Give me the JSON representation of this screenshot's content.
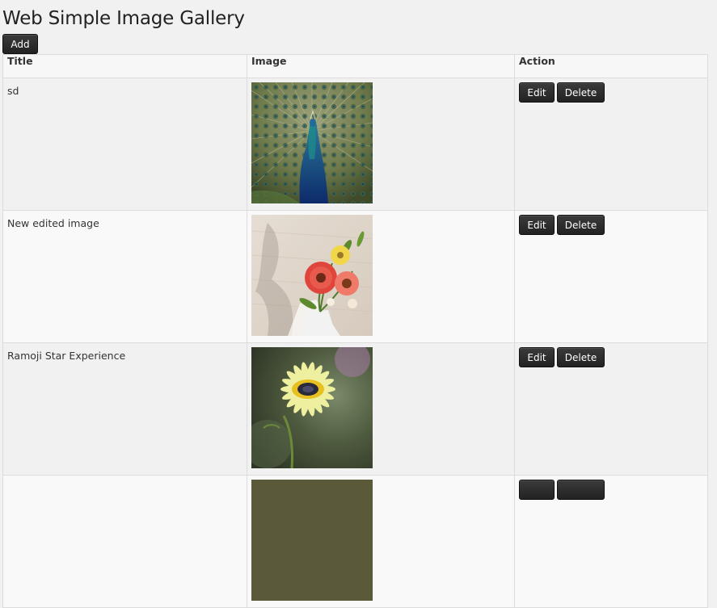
{
  "page": {
    "title": "Web Simple Image Gallery",
    "add_label": "Add"
  },
  "table": {
    "headers": {
      "title": "Title",
      "image": "Image",
      "action": "Action"
    },
    "rows": [
      {
        "title": "sd",
        "image": "peacock-photo",
        "edit_label": "Edit",
        "delete_label": "Delete"
      },
      {
        "title": "New edited image",
        "image": "gerbera-bouquet-photo",
        "edit_label": "Edit",
        "delete_label": "Delete"
      },
      {
        "title": "Ramoji Star Experience",
        "image": "yellow-daisy-photo",
        "edit_label": "Edit",
        "delete_label": "Delete"
      },
      {
        "title": "",
        "image": "partial-photo",
        "edit_label": "",
        "delete_label": ""
      }
    ]
  },
  "colors": {
    "background": "#f1f1f1",
    "button": "#2b2b2b",
    "border": "#dcdcdc"
  }
}
